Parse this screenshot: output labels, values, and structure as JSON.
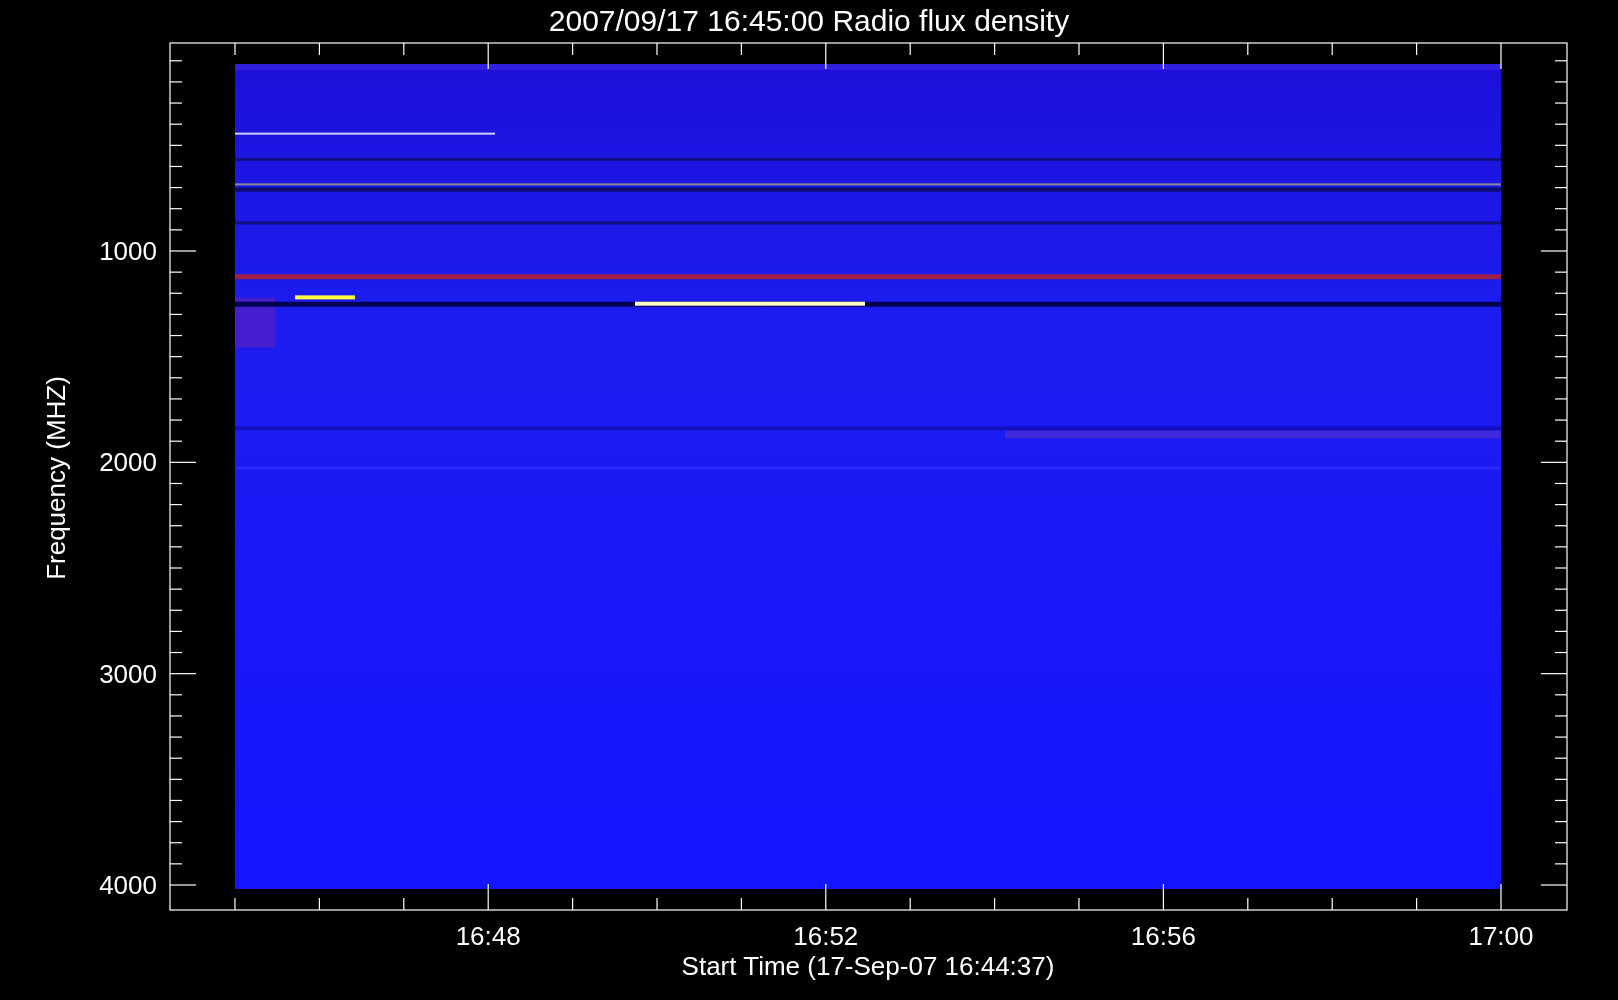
{
  "title": "2007/09/17 16:45:00 Radio flux density",
  "y_axis": {
    "label": "Frequency (MHZ)",
    "ticks": [
      "1000",
      "2000",
      "3000",
      "4000"
    ]
  },
  "x_axis": {
    "label": "Start Time (17-Sep-07 16:44:37)",
    "ticks": [
      "16:48",
      "16:52",
      "16:56",
      "17:00"
    ]
  }
}
